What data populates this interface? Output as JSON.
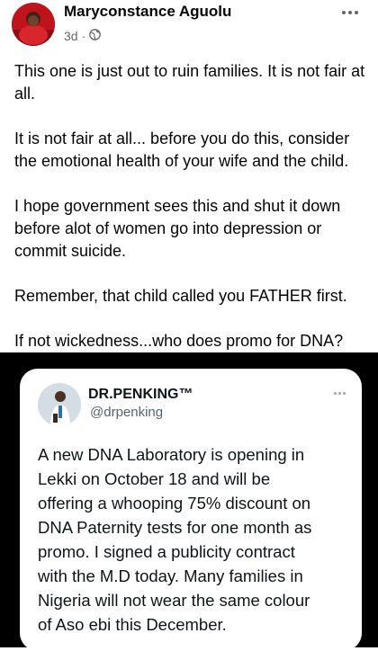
{
  "post": {
    "author_name": "Maryconstance Aguolu",
    "time_ago": "3d",
    "separator": "·",
    "audience_icon": "globe-icon",
    "more_icon": "more-horizontal-icon",
    "paragraphs": [
      "This one is just out to ruin families. It is not fair at all.",
      "It is not fair at all... before you do this, consider the emotional health of your wife and the child.",
      "I hope government sees this and shut it down before alot of women go into depression or commit suicide.",
      "Remember, that child called you FATHER first.",
      "If not wickedness...who does promo for DNA?"
    ]
  },
  "tweet": {
    "name": "DR.PENKING™",
    "handle": "@drpenking",
    "more_icon": "more-horizontal-icon",
    "lines": [
      "A new DNA Laboratory is opening in",
      "Lekki on October 18 and will be",
      "offering a whooping 75% discount on",
      "DNA Paternity tests for one month as",
      "promo. I signed a publicity contract",
      "with the M.D today. Many families in",
      "Nigeria will not wear the same colour",
      "of Aso ebi this December."
    ]
  },
  "colors": {
    "text_primary": "#050505",
    "text_secondary": "#65676b",
    "image_background": "#000000",
    "tweet_card": "#ffffff",
    "tweet_handle": "#536471"
  }
}
